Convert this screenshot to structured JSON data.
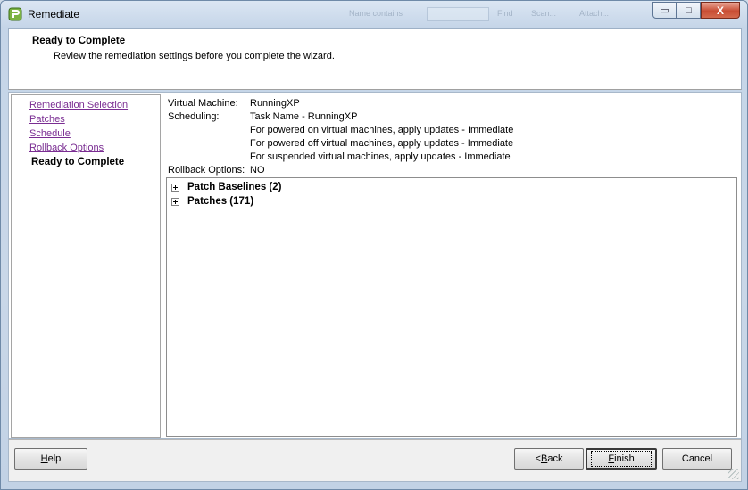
{
  "window": {
    "title": "Remediate",
    "background_hints": [
      "Name contains",
      "Find",
      "Scan...",
      "Attach..."
    ]
  },
  "titlebar_buttons": {
    "minimize": "▭",
    "maximize": "□",
    "close": "X"
  },
  "header": {
    "title": "Ready to Complete",
    "subtitle": "Review the remediation settings before you complete the wizard."
  },
  "nav": {
    "items": [
      {
        "label": "Remediation Selection",
        "current": false
      },
      {
        "label": "Patches",
        "current": false
      },
      {
        "label": "Schedule",
        "current": false
      },
      {
        "label": "Rollback Options",
        "current": false
      },
      {
        "label": "Ready to Complete",
        "current": true
      }
    ]
  },
  "summary": {
    "vm_label": "Virtual Machine:",
    "vm_value": "RunningXP",
    "scheduling_label": "Scheduling:",
    "scheduling_lines": [
      "Task Name - RunningXP",
      "For powered on virtual machines, apply updates - Immediate",
      "For powered off virtual machines, apply updates - Immediate",
      "For suspended virtual machines, apply updates - Immediate"
    ],
    "rollback_label": "Rollback Options:",
    "rollback_value": "NO"
  },
  "tree": {
    "nodes": [
      {
        "label": "Patch Baselines (2)"
      },
      {
        "label": "Patches (171)"
      }
    ]
  },
  "footer": {
    "help_label": "Help",
    "help_accel": "H",
    "help_rest": "elp",
    "back_label": "< Back",
    "back_pre": "< ",
    "back_accel": "B",
    "back_rest": "ack",
    "finish_label": "Finish",
    "finish_accel": "F",
    "finish_rest": "inish",
    "cancel_label": "Cancel"
  },
  "colors": {
    "link": "#7a2d92",
    "window_frame": "#c5d5e8",
    "close_button": "#c84d34"
  }
}
